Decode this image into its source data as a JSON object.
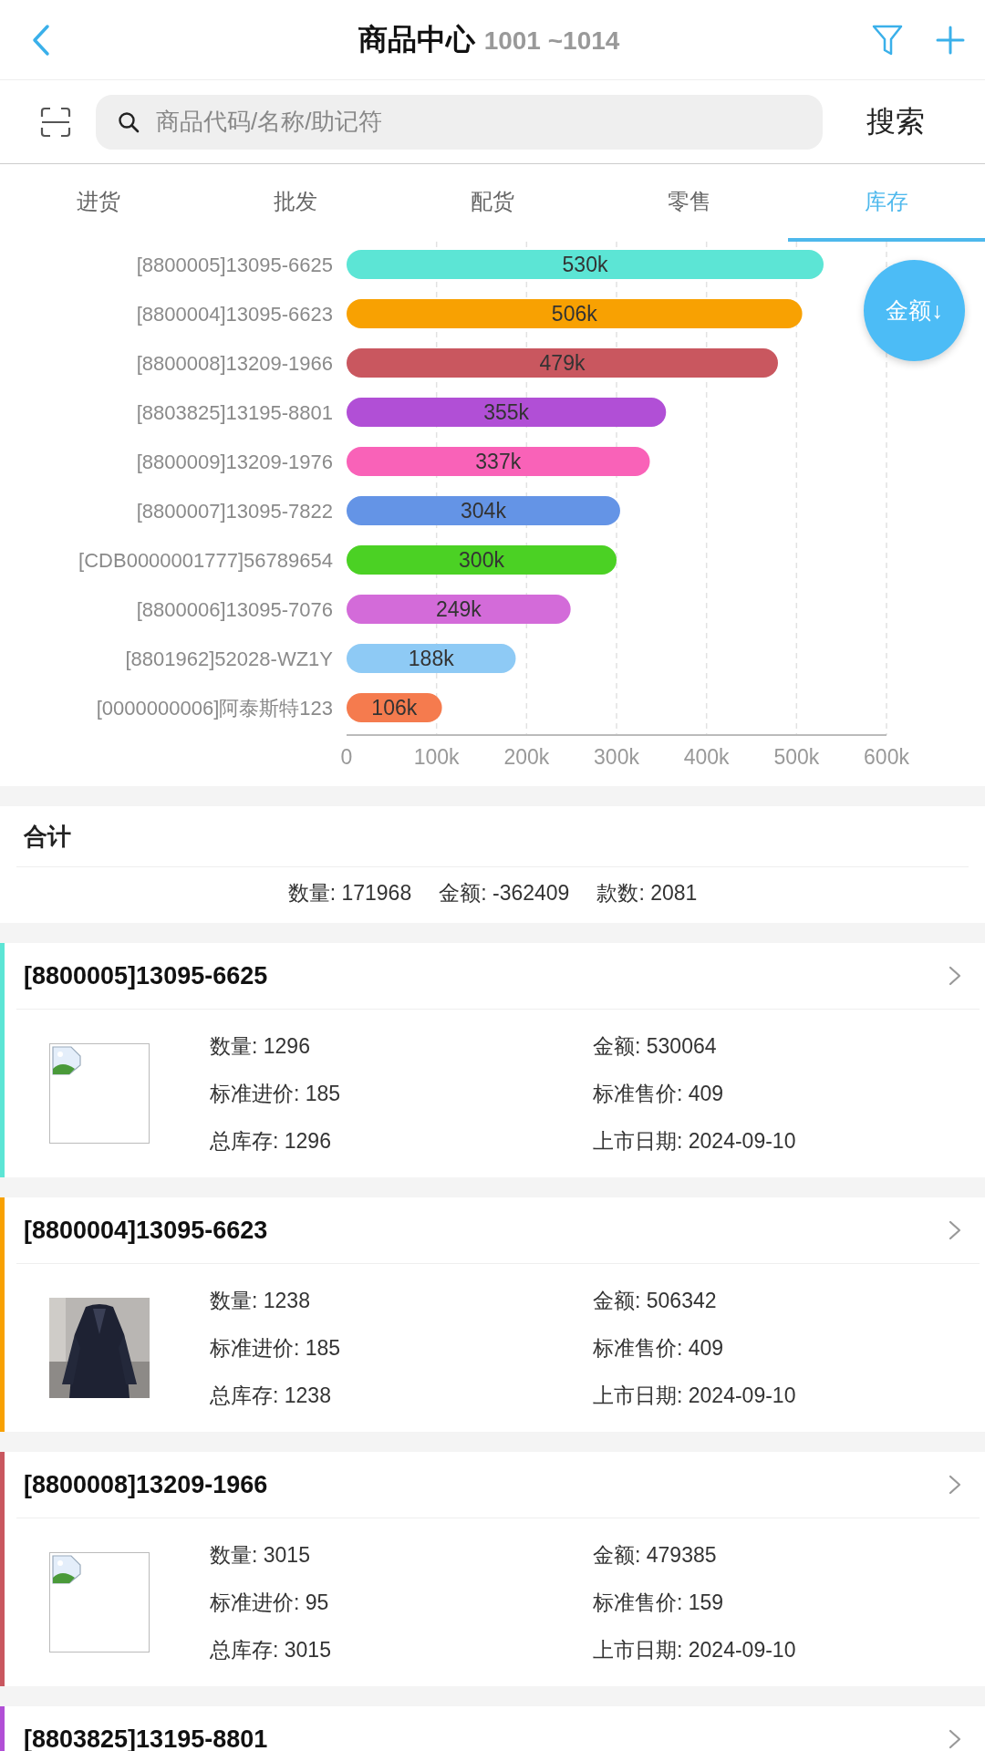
{
  "header": {
    "title": "商品中心",
    "subtitle": "1001 ~1014"
  },
  "search": {
    "placeholder": "商品代码/名称/助记符",
    "button": "搜索"
  },
  "tabs": [
    {
      "label": "进货",
      "selected": false
    },
    {
      "label": "批发",
      "selected": false
    },
    {
      "label": "配货",
      "selected": false
    },
    {
      "label": "零售",
      "selected": false
    },
    {
      "label": "库存",
      "selected": true
    }
  ],
  "sort_button": "金额↓",
  "chart_data": {
    "type": "bar",
    "orientation": "horizontal",
    "categories": [
      "[8800005]13095-6625",
      "[8800004]13095-6623",
      "[8800008]13209-1966",
      "[8803825]13195-8801",
      "[8800009]13209-1976",
      "[8800007]13095-7822",
      "[CDB0000001777]56789654",
      "[8800006]13095-7076",
      "[8801962]52028-WZ1Y",
      "[0000000006]阿泰斯特123"
    ],
    "values": [
      530064,
      506342,
      479385,
      355000,
      337000,
      304000,
      300000,
      249000,
      188000,
      106000
    ],
    "colors": [
      "#5ce5d5",
      "#f8a102",
      "#c9575f",
      "#b14fd6",
      "#f962b8",
      "#6494e6",
      "#4bd124",
      "#d36bd9",
      "#8ecaf5",
      "#f57b4e"
    ],
    "value_labels": [
      "530k",
      "506k",
      "479k",
      "355k",
      "337k",
      "304k",
      "300k",
      "249k",
      "188k",
      "106k"
    ],
    "xlim": [
      0,
      600000
    ],
    "grid": true,
    "xticks": [
      {
        "value": 0,
        "label": "0"
      },
      {
        "value": 100000,
        "label": "100k"
      },
      {
        "value": 200000,
        "label": "200k"
      },
      {
        "value": 300000,
        "label": "300k"
      },
      {
        "value": 400000,
        "label": "400k"
      },
      {
        "value": 500000,
        "label": "500k"
      },
      {
        "value": 600000,
        "label": "600k"
      }
    ]
  },
  "summary": {
    "title": "合计",
    "items": [
      "数量: 171968",
      "金额: -362409",
      "款数: 2081"
    ]
  },
  "products": [
    {
      "title": "[8800005]13095-6625",
      "color": "#5ce5d5",
      "image": {
        "kind": "broken"
      },
      "fields": [
        "数量: 1296",
        "金额: 530064",
        "标准进价: 185",
        "标准售价: 409",
        "总库存: 1296",
        "上市日期: 2024-09-10"
      ]
    },
    {
      "title": "[8800004]13095-6623",
      "color": "#f8a102",
      "image": {
        "kind": "picture"
      },
      "fields": [
        "数量: 1238",
        "金额: 506342",
        "标准进价: 185",
        "标准售价: 409",
        "总库存: 1238",
        "上市日期: 2024-09-10"
      ]
    },
    {
      "title": "[8800008]13209-1966",
      "color": "#c9575f",
      "image": {
        "kind": "broken"
      },
      "fields": [
        "数量: 3015",
        "金额: 479385",
        "标准进价: 95",
        "标准售价: 159",
        "总库存: 3015",
        "上市日期: 2024-09-10"
      ]
    },
    {
      "title": "[8803825]13195-8801",
      "color": "#b14fd6"
    }
  ]
}
